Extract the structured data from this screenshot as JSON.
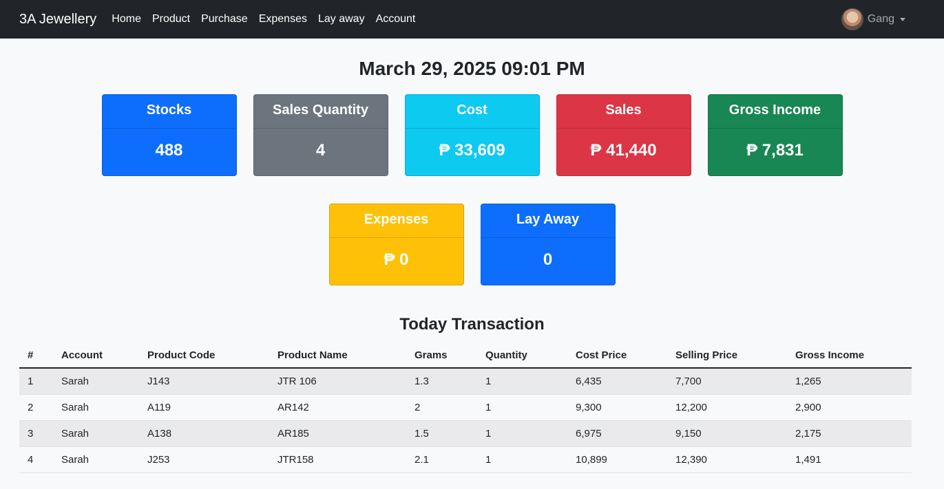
{
  "navbar": {
    "brand": "3A Jewellery",
    "links": [
      "Home",
      "Product",
      "Purchase",
      "Expenses",
      "Lay away",
      "Account"
    ],
    "user": "Gang"
  },
  "datetime": "March 29, 2025 09:01 PM",
  "cards": [
    {
      "title": "Stocks",
      "value": "488",
      "color": "#0d6efd"
    },
    {
      "title": "Sales Quantity",
      "value": "4",
      "color": "#6c757d"
    },
    {
      "title": "Cost",
      "value": "₱ 33,609",
      "color": "#0dcaf0"
    },
    {
      "title": "Sales",
      "value": "₱ 41,440",
      "color": "#dc3545"
    },
    {
      "title": "Gross Income",
      "value": "₱ 7,831",
      "color": "#198754"
    },
    {
      "title": "Expenses",
      "value": "₱ 0",
      "color": "#ffc107"
    },
    {
      "title": "Lay Away",
      "value": "0",
      "color": "#0d6efd"
    }
  ],
  "transactions": {
    "title": "Today Transaction",
    "headers": [
      "#",
      "Account",
      "Product Code",
      "Product Name",
      "Grams",
      "Quantity",
      "Cost Price",
      "Selling Price",
      "Gross Income"
    ],
    "rows": [
      [
        "1",
        "Sarah",
        "J143",
        "JTR 106",
        "1.3",
        "1",
        "6,435",
        "7,700",
        "1,265"
      ],
      [
        "2",
        "Sarah",
        "A119",
        "AR142",
        "2",
        "1",
        "9,300",
        "12,200",
        "2,900"
      ],
      [
        "3",
        "Sarah",
        "A138",
        "AR185",
        "1.5",
        "1",
        "6,975",
        "9,150",
        "2,175"
      ],
      [
        "4",
        "Sarah",
        "J253",
        "JTR158",
        "2.1",
        "1",
        "10,899",
        "12,390",
        "1,491"
      ]
    ]
  }
}
